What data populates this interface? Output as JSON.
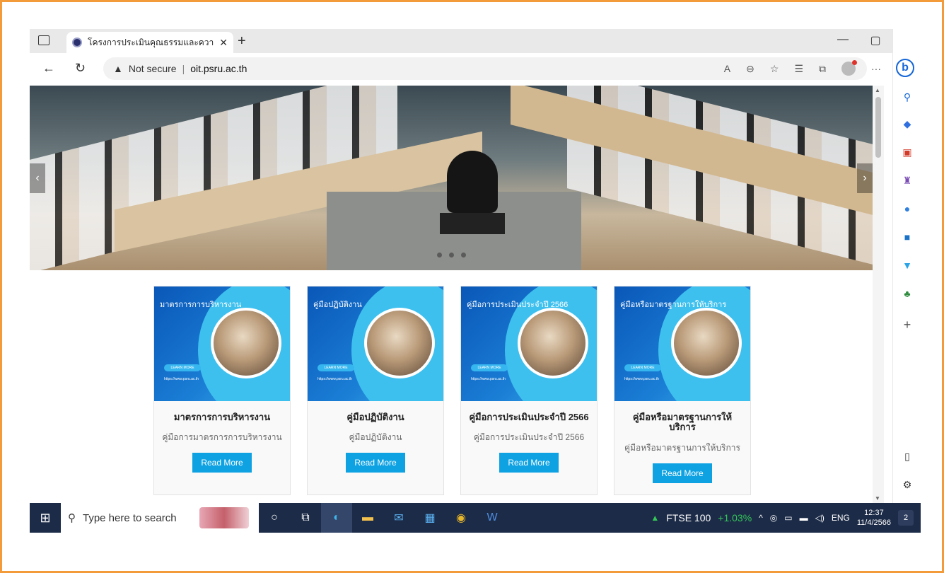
{
  "browser": {
    "tab_title": "โครงการประเมินคุณธรรมและความโปร่",
    "new_tab": "+",
    "security_label": "Not secure",
    "url": "oit.psru.ac.th",
    "window_minimize": "—",
    "window_restore": "▢",
    "window_close": "✕"
  },
  "hero": {
    "slides": 3
  },
  "cards": [
    {
      "image_title": "มาตรการการบริหารงาน",
      "title": "มาตรการการบริหารงาน",
      "text": "คู่มือการมาตรการการบริหารงาน",
      "button": "Read More"
    },
    {
      "image_title": "คู่มือปฏิบัติงาน",
      "title": "คู่มือปฏิบัติงาน",
      "text": "คู่มือปฏิบัติงาน",
      "button": "Read More"
    },
    {
      "image_title": "คู่มือการประเมินประจำปี 2566",
      "title": "คู่มือการประเมินประจำปี 2566",
      "text": "คู่มือการประเมินประจำปี 2566",
      "button": "Read More"
    },
    {
      "image_title": "คู่มือหรือมาตรฐานการให้บริการ",
      "title": "คู่มือหรือมาตรฐานการให้บริการ",
      "text": "คู่มือหรือมาตรฐานการให้บริการ",
      "button": "Read More"
    }
  ],
  "card_image": {
    "pill": "LEARN MORE",
    "url": "https://www.psru.ac.th"
  },
  "taskbar": {
    "search_placeholder": "Type here to search",
    "ftse_label": "FTSE 100",
    "ftse_change": "+1.03%",
    "language": "ENG",
    "time": "12:37",
    "date": "11/4/2566",
    "notifications": "2"
  },
  "colors": {
    "frame": "#f39a3a",
    "button": "#0ea2e3",
    "taskbar": "#1c2b47",
    "bing": "#1466d8"
  }
}
